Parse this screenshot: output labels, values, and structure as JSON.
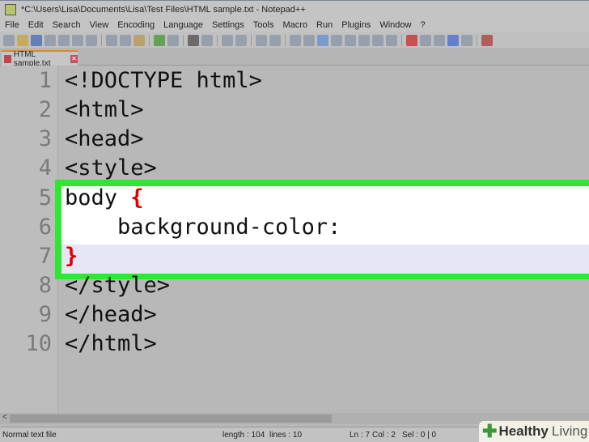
{
  "window": {
    "title": "*C:\\Users\\Lisa\\Documents\\Lisa\\Test Files\\HTML sample.txt - Notepad++"
  },
  "menu": [
    "File",
    "Edit",
    "Search",
    "View",
    "Encoding",
    "Language",
    "Settings",
    "Tools",
    "Macro",
    "Run",
    "Plugins",
    "Window",
    "?"
  ],
  "tab": {
    "label": "HTML sample.txt",
    "close": "✕"
  },
  "editor": {
    "lines": [
      {
        "num": "1",
        "text": "<!DOCTYPE html>"
      },
      {
        "num": "2",
        "text": "<html>"
      },
      {
        "num": "3",
        "text": "<head>"
      },
      {
        "num": "4",
        "text": "<style>"
      },
      {
        "num": "5",
        "text": "body ",
        "brace": "{"
      },
      {
        "num": "6",
        "text": "    background-color:"
      },
      {
        "num": "7",
        "text": "",
        "brace": "}"
      },
      {
        "num": "8",
        "text": "</style>"
      },
      {
        "num": "9",
        "text": "</head>"
      },
      {
        "num": "10",
        "text": "</html>"
      }
    ]
  },
  "scroll": {
    "left_arrow": "<"
  },
  "status": {
    "type": "Normal text file",
    "length": "length : 104",
    "lines": "lines : 10",
    "ln": "Ln : 7",
    "col": "Col : 2",
    "sel": "Sel : 0 | 0"
  },
  "watermark": {
    "brand": "Healthy",
    "brand2": "Living"
  }
}
